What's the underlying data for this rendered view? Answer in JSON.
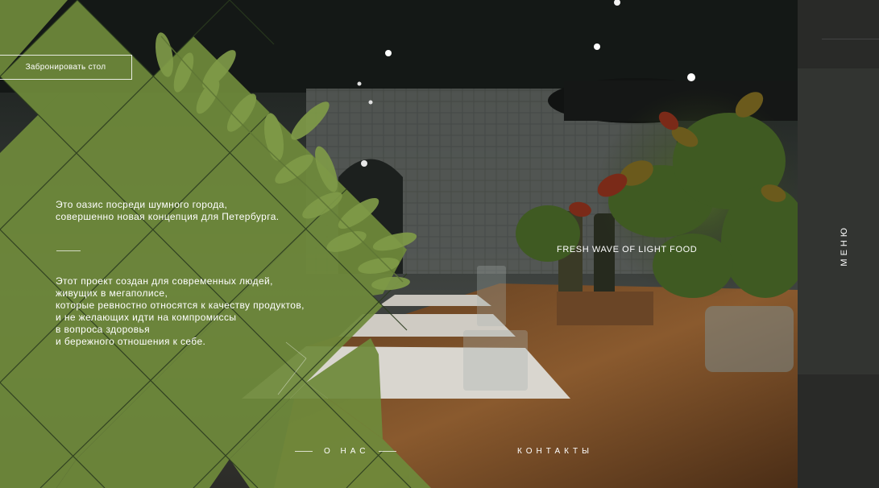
{
  "header": {
    "reserve_button": "Забронировать стол"
  },
  "intro": {
    "lines": [
      "Это оазис посреди шумного города,",
      "совершенно новая концепция для Петербурга."
    ]
  },
  "description": {
    "lines": [
      "Этот проект создан для современных людей,",
      "живущих в мегаполисе,",
      "которые ревностно относятся к качеству продуктов,",
      "и не желающих идти на компромиссы",
      "в вопроса здоровья",
      "и бережного отношения к себе."
    ]
  },
  "tagline": "FRESH WAVE OF LIGHT FOOD",
  "nav": {
    "about": "О НАС",
    "contacts": "КОНТАКТЫ"
  },
  "menu": {
    "label": "МЕНЮ"
  },
  "colors": {
    "green": "#6f8a3b",
    "dark": "#22231f",
    "menu_strip": "#292a28",
    "wood": "#8a5a2e"
  },
  "icons": [
    "leaf-icon"
  ]
}
